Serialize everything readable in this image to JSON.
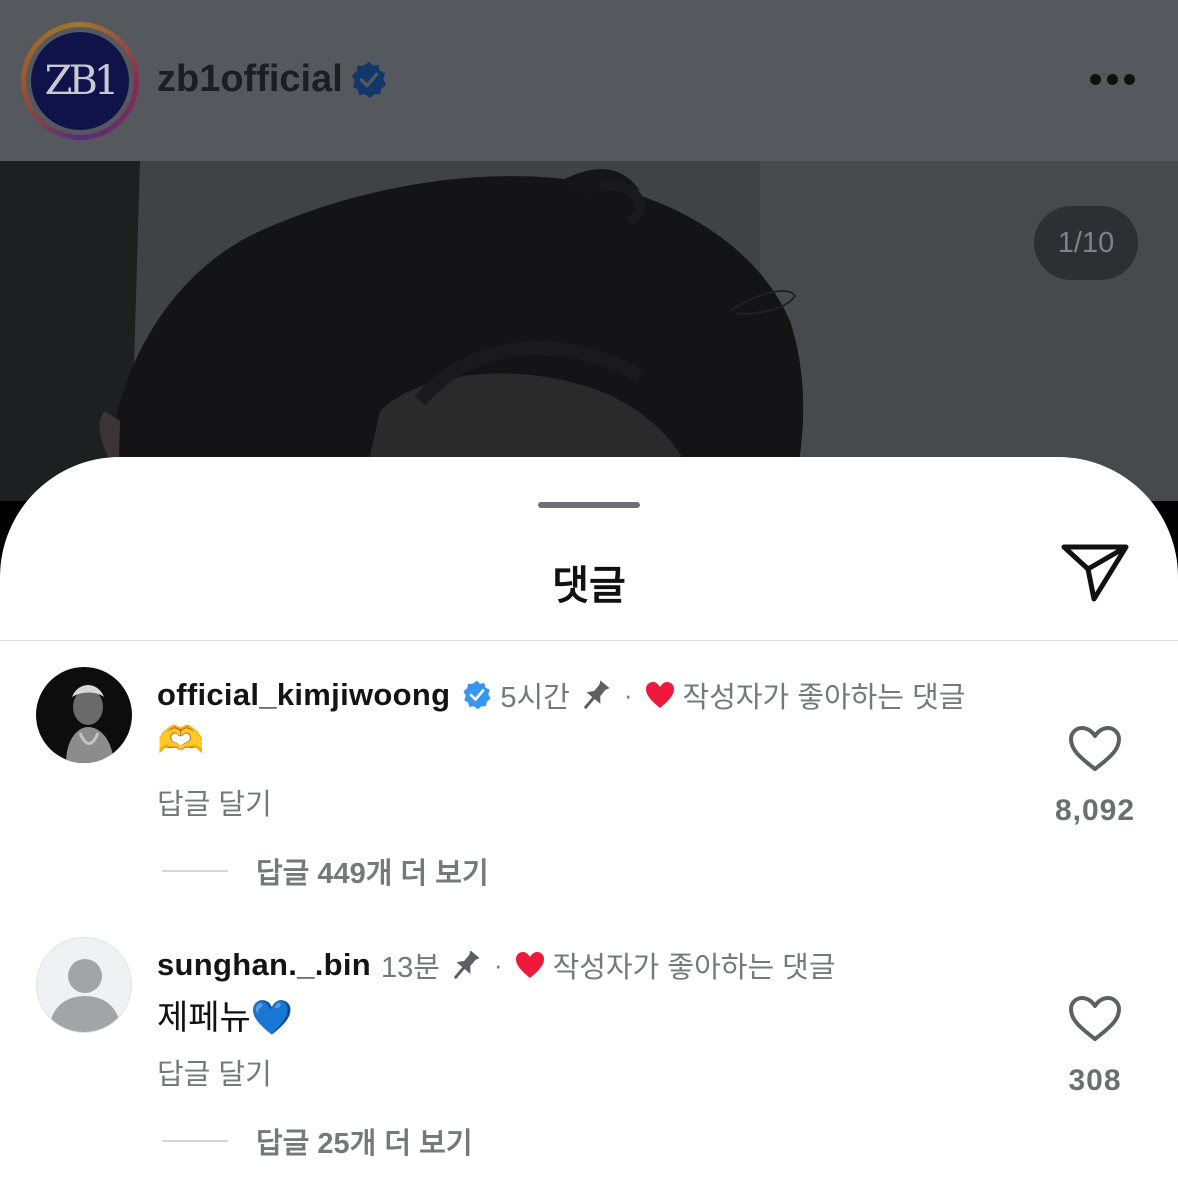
{
  "post": {
    "logo_text": "ZB1",
    "username": "zb1official",
    "verified": true,
    "carousel_position": "1/10"
  },
  "sheet": {
    "title": "댓글"
  },
  "comments": [
    {
      "username": "official_kimjiwoong",
      "verified": true,
      "time": "5시간",
      "pinned": true,
      "separator": "·",
      "liked_by_author_label": "작성자가 좋아하는 댓글",
      "text": "🫶",
      "reply_label": "답글 달기",
      "view_replies_label": "답글 449개 더 보기",
      "like_count": "8,092"
    },
    {
      "username": "sunghan._.bin",
      "verified": false,
      "time": "13분",
      "pinned": true,
      "separator": "·",
      "liked_by_author_label": "작성자가 좋아하는 댓글",
      "text": "제페뉴💙",
      "reply_label": "답글 달기",
      "view_replies_label": "답글 25개 더 보기",
      "like_count": "308"
    }
  ],
  "colors": {
    "verified_blue": "#3797f0",
    "heart_red": "#ed1a3b",
    "overlay_gray": "#55585c"
  },
  "icons": [
    "verified-icon",
    "more-icon",
    "share-icon",
    "pin-icon",
    "heart-icon",
    "default-avatar-icon"
  ]
}
